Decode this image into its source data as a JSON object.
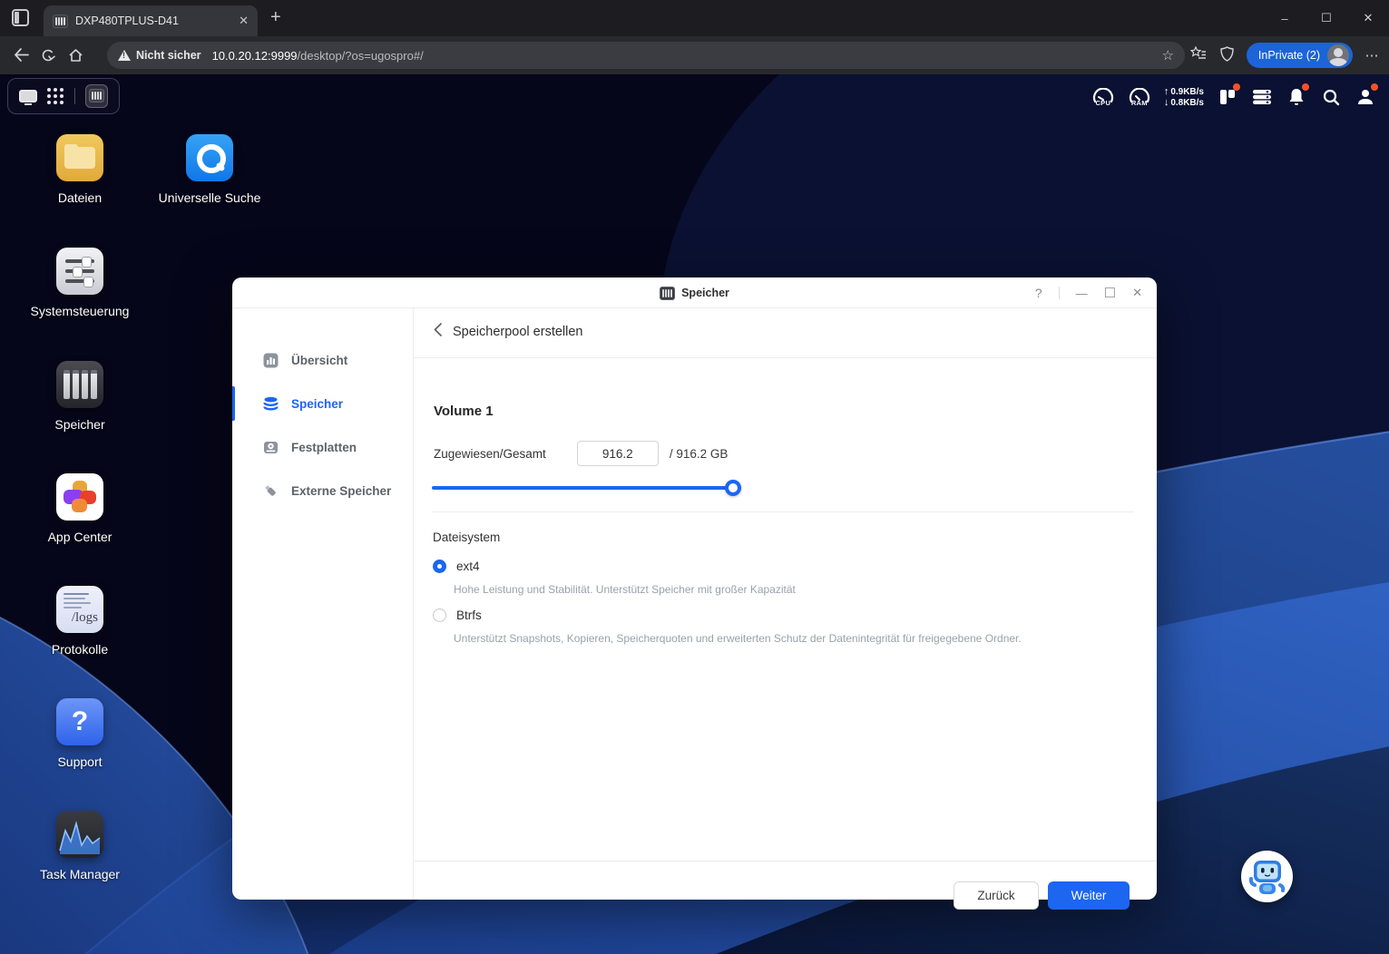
{
  "browser": {
    "tab_title": "DXP480TPLUS-D41",
    "close_glyph": "✕",
    "new_tab_glyph": "+",
    "security_warning": "Nicht sicher",
    "url_host": "10.0.20.12:9999",
    "url_path": "/desktop/?os=ugospro#/",
    "inprivate_badge": "InPrivate (2)",
    "minimize_glyph": "–",
    "maximize_glyph": "☐",
    "close_win_glyph": "✕"
  },
  "taskbar": {
    "cpu_label": "CPU",
    "ram_label": "RAM",
    "net_up": "0.9KB/s",
    "net_down": "0.8KB/s"
  },
  "desktop": {
    "icons": [
      {
        "label": "Dateien"
      },
      {
        "label": "Universelle Suche"
      },
      {
        "label": "Systemsteuerung"
      },
      {
        "label": "Speicher"
      },
      {
        "label": "App Center"
      },
      {
        "label": "Protokolle",
        "badge": "/logs"
      },
      {
        "label": "Support",
        "glyph": "?"
      },
      {
        "label": "Task Manager"
      }
    ]
  },
  "dialog": {
    "title": "Speicher",
    "help_glyph": "?",
    "minimize_glyph": "—",
    "maximize_glyph": "☐",
    "close_glyph": "✕",
    "sidebar": [
      {
        "label": "Übersicht"
      },
      {
        "label": "Speicher"
      },
      {
        "label": "Festplatten"
      },
      {
        "label": "Externe Speicher"
      }
    ],
    "breadcrumb": "Speicherpool erstellen",
    "volume_title": "Volume 1",
    "allocated_label": "Zugewiesen/Gesamt",
    "allocated_value": "916.2",
    "total_suffix": "/  916.2 GB",
    "filesystem_label": "Dateisystem",
    "options": [
      {
        "name": "ext4",
        "desc": "Hohe Leistung und Stabilität. Unterstützt Speicher mit großer Kapazität"
      },
      {
        "name": "Btrfs",
        "desc": "Unterstützt Snapshots, Kopieren, Speicherquoten und erweiterten Schutz der Datenintegrität für freigegebene Ordner."
      }
    ],
    "back_label": "Zurück",
    "next_label": "Weiter"
  },
  "colors": {
    "accent": "#1c66f0",
    "inprivate": "#1c64d8",
    "badge_red": "#f4512c"
  }
}
